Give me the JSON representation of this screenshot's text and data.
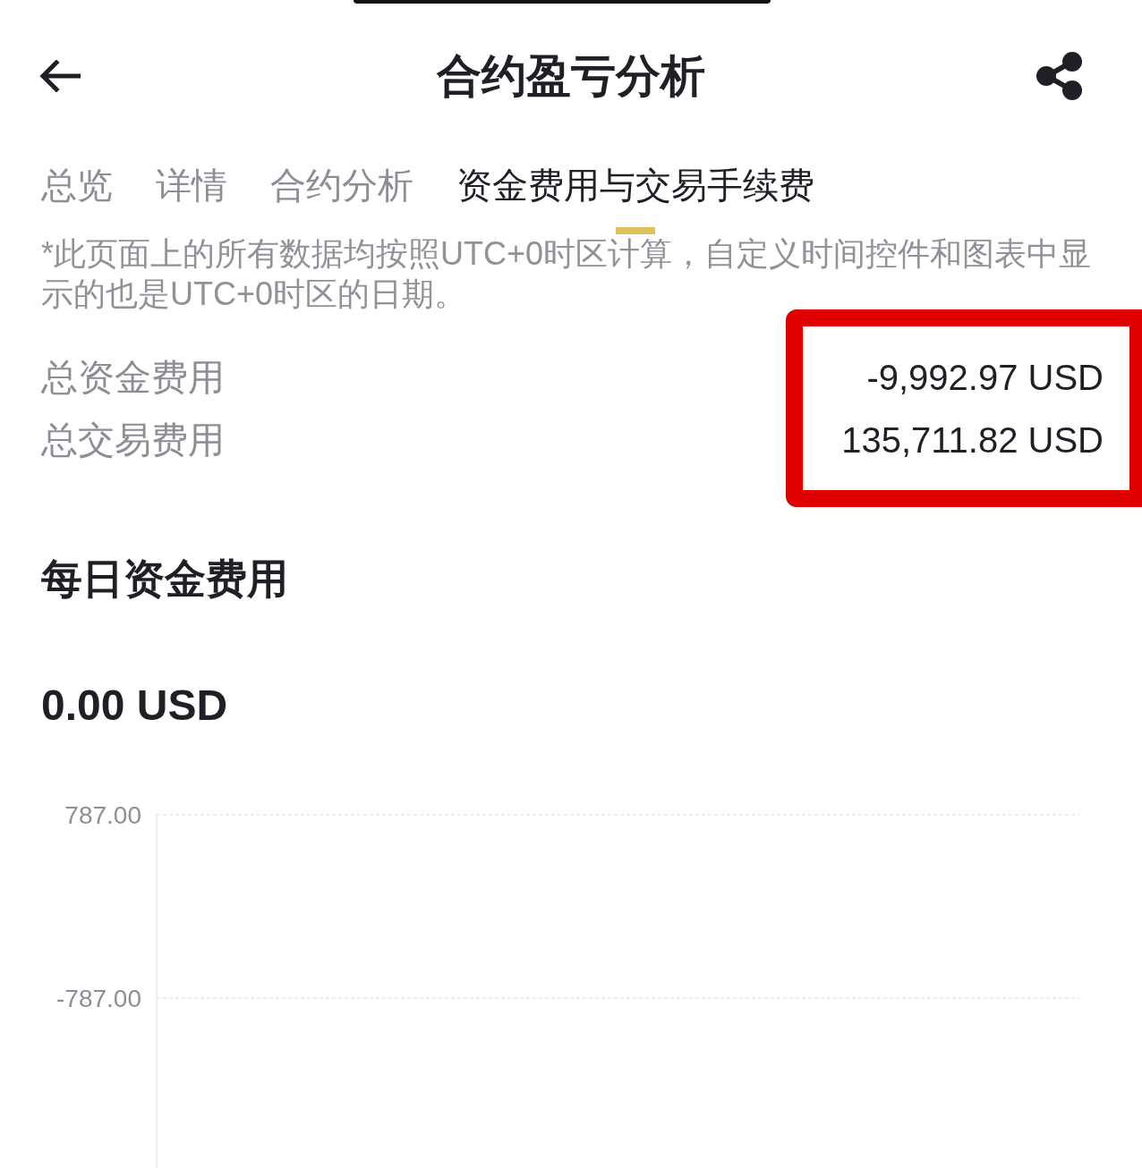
{
  "header": {
    "title": "合约盈亏分析"
  },
  "tabs": [
    {
      "label": "总览",
      "selected": false
    },
    {
      "label": "详情",
      "selected": false
    },
    {
      "label": "合约分析",
      "selected": false
    },
    {
      "label": "资金费用与交易手续费",
      "selected": true
    }
  ],
  "note": "*此页面上的所有数据均按照UTC+0时区计算，自定义时间控件和图表中显示的也是UTC+0时区的日期。",
  "totals": {
    "highlighted": true,
    "rows": [
      {
        "label": "总资金费用",
        "value": "-9,992.97 USD"
      },
      {
        "label": "总交易费用",
        "value": "135,711.82 USD"
      }
    ]
  },
  "daily_funding": {
    "title": "每日资金费用",
    "amount": "0.00 USD",
    "chart": {
      "y_labels": [
        "787.00",
        "-787.00"
      ]
    }
  }
}
